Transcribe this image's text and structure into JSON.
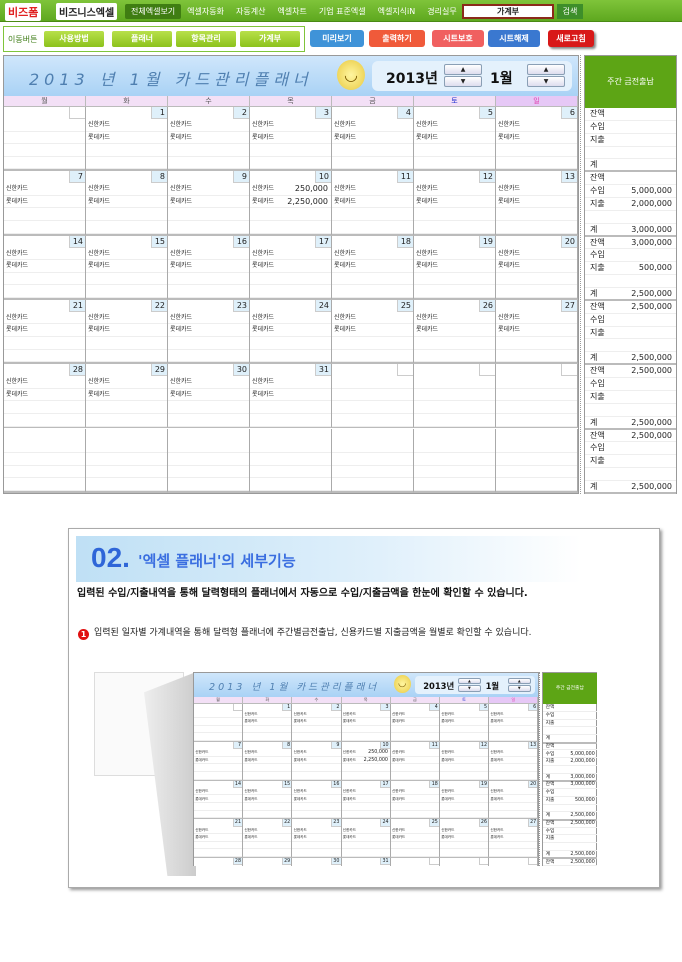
{
  "header": {
    "logo_main": "비즈폼",
    "logo_sub": "비즈니스엑셀",
    "nav": [
      "전체엑셀보기",
      "엑셀자동화",
      "자동계산",
      "엑셀차트",
      "기업 표준엑셀",
      "엑셀지식iN",
      "경리실무"
    ],
    "search_value": "가계부",
    "search_button": "검색"
  },
  "toolbar": {
    "move_label": "이동버튼",
    "move_buttons": [
      "사용방법",
      "플래너",
      "항목관리",
      "가계부"
    ],
    "preview": "미리보기",
    "print": "출력하기",
    "protect": "시트보호",
    "unprotect": "시트해제",
    "refresh": "새로고침"
  },
  "colors": {
    "accent": "#5da515",
    "header_blue": "#a9d2f5",
    "preview": "#3f93d8",
    "print": "#f05a3a",
    "protect": "#f06060",
    "unprotect": "#3a78d0",
    "refresh": "#d81818"
  },
  "calendar": {
    "title": "2013 년  1월  카드관리플래너",
    "year_label": "2013년",
    "month_label": "1월",
    "weekdays": [
      "월",
      "화",
      "수",
      "목",
      "금",
      "토",
      "일"
    ],
    "weeks": [
      [
        {
          "d": ""
        },
        {
          "d": "1",
          "c": 1
        },
        {
          "d": "2",
          "c": 1
        },
        {
          "d": "3",
          "c": 1
        },
        {
          "d": "4",
          "c": 1
        },
        {
          "d": "5",
          "c": 1
        },
        {
          "d": "6",
          "c": 1
        }
      ],
      [
        {
          "d": "7",
          "c": 1
        },
        {
          "d": "8",
          "c": 1
        },
        {
          "d": "9",
          "c": 1
        },
        {
          "d": "10",
          "c": 1,
          "v1": "250,000",
          "v2": "2,250,000"
        },
        {
          "d": "11",
          "c": 1
        },
        {
          "d": "12",
          "c": 1
        },
        {
          "d": "13",
          "c": 1
        }
      ],
      [
        {
          "d": "14",
          "c": 1
        },
        {
          "d": "15",
          "c": 1
        },
        {
          "d": "16",
          "c": 1
        },
        {
          "d": "17",
          "c": 1
        },
        {
          "d": "18",
          "c": 1
        },
        {
          "d": "19",
          "c": 1
        },
        {
          "d": "20",
          "c": 1
        }
      ],
      [
        {
          "d": "21",
          "c": 1
        },
        {
          "d": "22",
          "c": 1
        },
        {
          "d": "23",
          "c": 1
        },
        {
          "d": "24",
          "c": 1
        },
        {
          "d": "25",
          "c": 1
        },
        {
          "d": "26",
          "c": 1
        },
        {
          "d": "27",
          "c": 1
        }
      ],
      [
        {
          "d": "28",
          "c": 1
        },
        {
          "d": "29",
          "c": 1
        },
        {
          "d": "30",
          "c": 1
        },
        {
          "d": "31",
          "c": 1
        },
        {
          "d": ""
        },
        {
          "d": ""
        },
        {
          "d": ""
        }
      ],
      [
        {
          "n": 1
        },
        {
          "n": 1
        },
        {
          "n": 1
        },
        {
          "n": 1
        },
        {
          "n": 1
        },
        {
          "n": 1
        },
        {
          "n": 1
        }
      ]
    ],
    "cards": [
      "신한카드",
      "롯데카드"
    ]
  },
  "weekly": {
    "title": "주간 금전출납",
    "labels": [
      "잔액",
      "수입",
      "지출",
      "",
      "계"
    ],
    "weeks": [
      [
        "",
        "",
        "",
        "",
        ""
      ],
      [
        "",
        "5,000,000",
        "2,000,000",
        "",
        "3,000,000"
      ],
      [
        "3,000,000",
        "",
        "500,000",
        "",
        "2,500,000"
      ],
      [
        "2,500,000",
        "",
        "",
        "",
        "2,500,000"
      ],
      [
        "2,500,000",
        "",
        "",
        "",
        "2,500,000"
      ],
      [
        "2,500,000",
        "",
        "",
        "",
        "2,500,000"
      ]
    ]
  },
  "section": {
    "number": "02.",
    "title": "'엑셀 플래너'의 세부기능",
    "lead": "입력된 수입/지출내역을 통해 달력형태의 플래너에서 자동으로 수입/지출금액을 한눈에 확인할 수 있습니다.",
    "bullet_no": "1",
    "bullet": "입력된 일자별 가계내역을 통해 달력형 플래너에 주간별금전출납, 신용카드별 지출금액을 월별로 확인할 수 있습니다."
  }
}
